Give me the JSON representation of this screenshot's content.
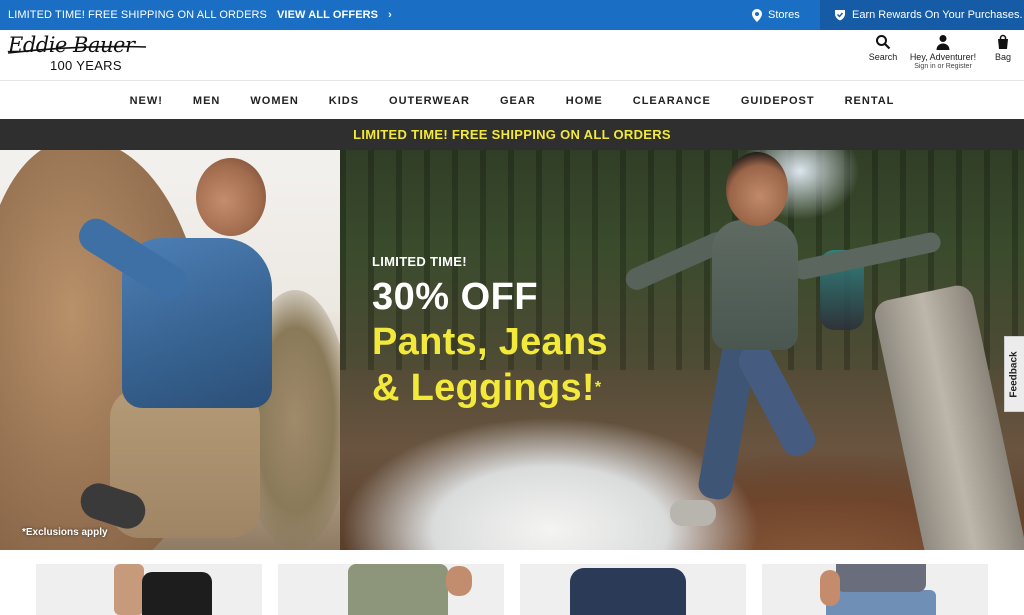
{
  "topbar": {
    "promo_text": "LIMITED TIME! FREE SHIPPING ON ALL ORDERS",
    "offers_link": "VIEW ALL OFFERS",
    "stores_label": "Stores",
    "rewards_label": "Earn Rewards On Your Purchases.",
    "background_color": "#1a6fc4"
  },
  "header": {
    "logo_text": "Eddie Bauer",
    "logo_subtext": "100 YEARS",
    "search_label": "Search",
    "account_label": "Hey, Adventurer!",
    "account_sublabel": "Sign in or Register",
    "bag_label": "Bag"
  },
  "nav": {
    "items": [
      "NEW!",
      "MEN",
      "WOMEN",
      "KIDS",
      "OUTERWEAR",
      "GEAR",
      "HOME",
      "CLEARANCE",
      "GUIDEPOST",
      "RENTAL"
    ]
  },
  "shipping_banner": {
    "text": "LIMITED TIME! FREE SHIPPING ON ALL ORDERS",
    "text_color": "#f2e93a"
  },
  "hero": {
    "kicker": "LIMITED TIME!",
    "headline": "30% OFF",
    "products_line1": "Pants, Jeans",
    "products_line2": "& Leggings!",
    "asterisk": "*",
    "exclusions": "*Exclusions apply",
    "accent_color": "#f2e93a"
  },
  "feedback_tab": {
    "label": "Feedback"
  },
  "product_tiles": {
    "icons": [
      "leggings-image",
      "cargo-pants-image",
      "joggers-image",
      "jeans-image"
    ]
  }
}
